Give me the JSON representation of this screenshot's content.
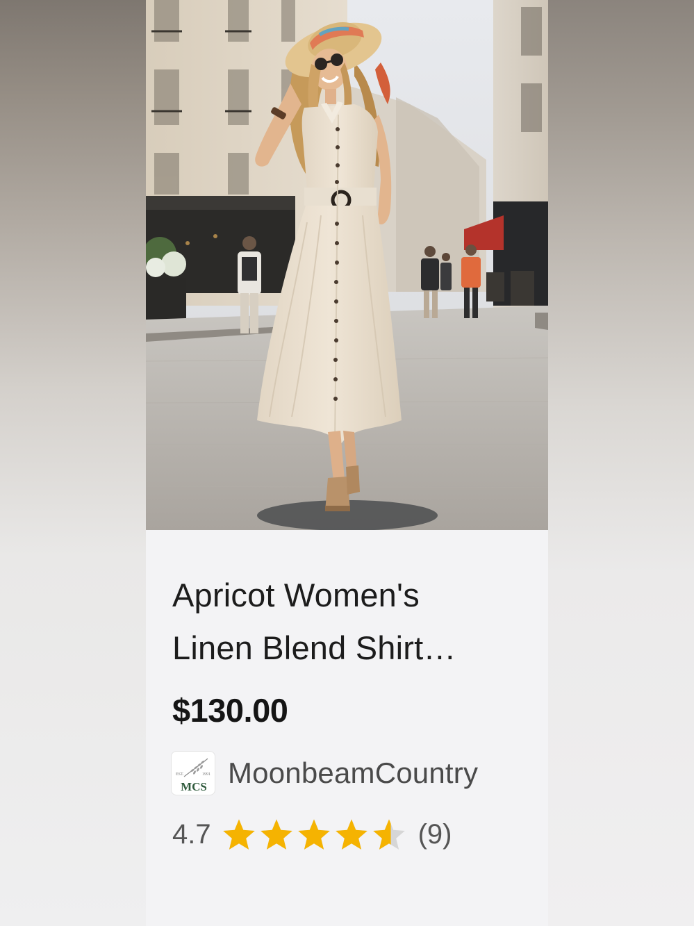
{
  "product": {
    "title_line1": "Apricot Women's",
    "title_line2": "Linen Blend Shirt…",
    "price": "$130.00"
  },
  "shop": {
    "name": "MoonbeamCountry",
    "logo_text": "MCS",
    "logo_est_left": "EST.",
    "logo_est_right": "1991"
  },
  "rating": {
    "value": "4.7",
    "review_count": "(9)",
    "stars_filled": 4.7,
    "stars_total": 5,
    "star_color": "#f5b301",
    "star_empty_color": "#d6d6d6"
  },
  "icons": {
    "photo": "product-photo-woman-dress",
    "star": "star-icon",
    "logo": "shop-logo-wheat"
  }
}
